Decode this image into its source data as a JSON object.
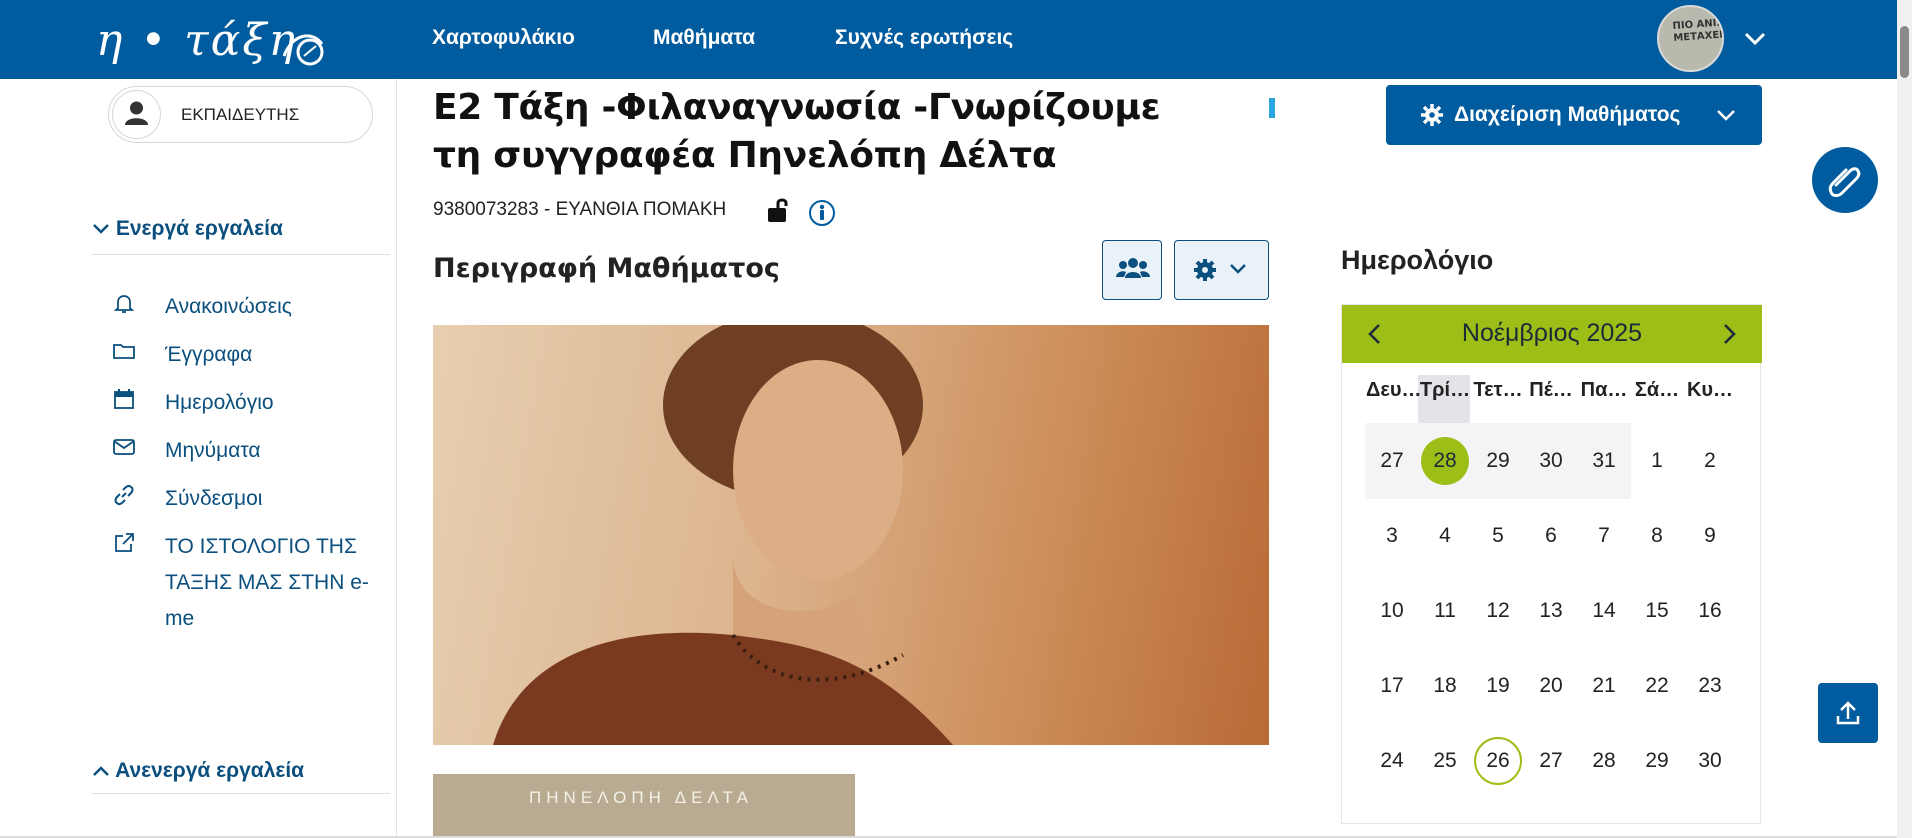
{
  "header": {
    "logo_text": "η • τάξη",
    "nav": [
      "Χαρτοφυλάκιο",
      "Μαθήματα",
      "Συχνές ερωτήσεις"
    ],
    "avatar_text": "ΠΙΟ ΑΝΙΣΟ\nΜΕΤΑΧΕΙΡ"
  },
  "sidebar": {
    "role": "ΕΚΠΑΙΔΕΥΤΗΣ",
    "active_tools_label": "Ενεργά εργαλεία",
    "inactive_tools_label": "Ανενεργά εργαλεία",
    "tools": [
      {
        "label": "Ανακοινώσεις",
        "icon": "bell-icon"
      },
      {
        "label": "Έγγραφα",
        "icon": "folder-icon"
      },
      {
        "label": "Ημερολόγιο",
        "icon": "calendar-icon"
      },
      {
        "label": "Μηνύματα",
        "icon": "envelope-icon"
      },
      {
        "label": "Σύνδεσμοι",
        "icon": "link-icon"
      },
      {
        "label": "ΤΟ ΙΣΤΟΛΟΓΙΟ ΤΗΣ ΤΑΞΗΣ ΜΑΣ ΣΤΗΝ e-me",
        "icon": "external-link-icon"
      }
    ]
  },
  "course": {
    "title": "Ε2 Τάξη -Φιλαναγνωσία -Γνωρίζουμε τη συγγραφέα Πηνελόπη Δέλτα",
    "code": "9380073283",
    "separator": "-",
    "teacher": "ΕΥΑΝΘΙΑ ΠΟΜΑΚΗ",
    "description_heading": "Περιγραφή Μαθήματος",
    "book_cover_text": "ΠΗΝΕΛΟΠΗ ΔΕΛΤΑ"
  },
  "manage_button_label": "Διαχείριση Μαθήματος",
  "calendar": {
    "heading": "Ημερολόγιο",
    "month_label": "Νοέμβριος 2025",
    "weekdays": [
      "Δευ…",
      "Τρί…",
      "Τετ…",
      "Πέ…",
      "Πα…",
      "Σά…",
      "Κυ…"
    ],
    "weeks": [
      [
        "27",
        "28",
        "29",
        "30",
        "31",
        "1",
        "2"
      ],
      [
        "3",
        "4",
        "5",
        "6",
        "7",
        "8",
        "9"
      ],
      [
        "10",
        "11",
        "12",
        "13",
        "14",
        "15",
        "16"
      ],
      [
        "17",
        "18",
        "19",
        "20",
        "21",
        "22",
        "23"
      ],
      [
        "24",
        "25",
        "26",
        "27",
        "28",
        "29",
        "30"
      ]
    ],
    "today": "28",
    "ringed_day": "26",
    "accent_color": "#9cbe16"
  },
  "colors": {
    "primary": "#005c9e",
    "link": "#0b4f7e"
  }
}
